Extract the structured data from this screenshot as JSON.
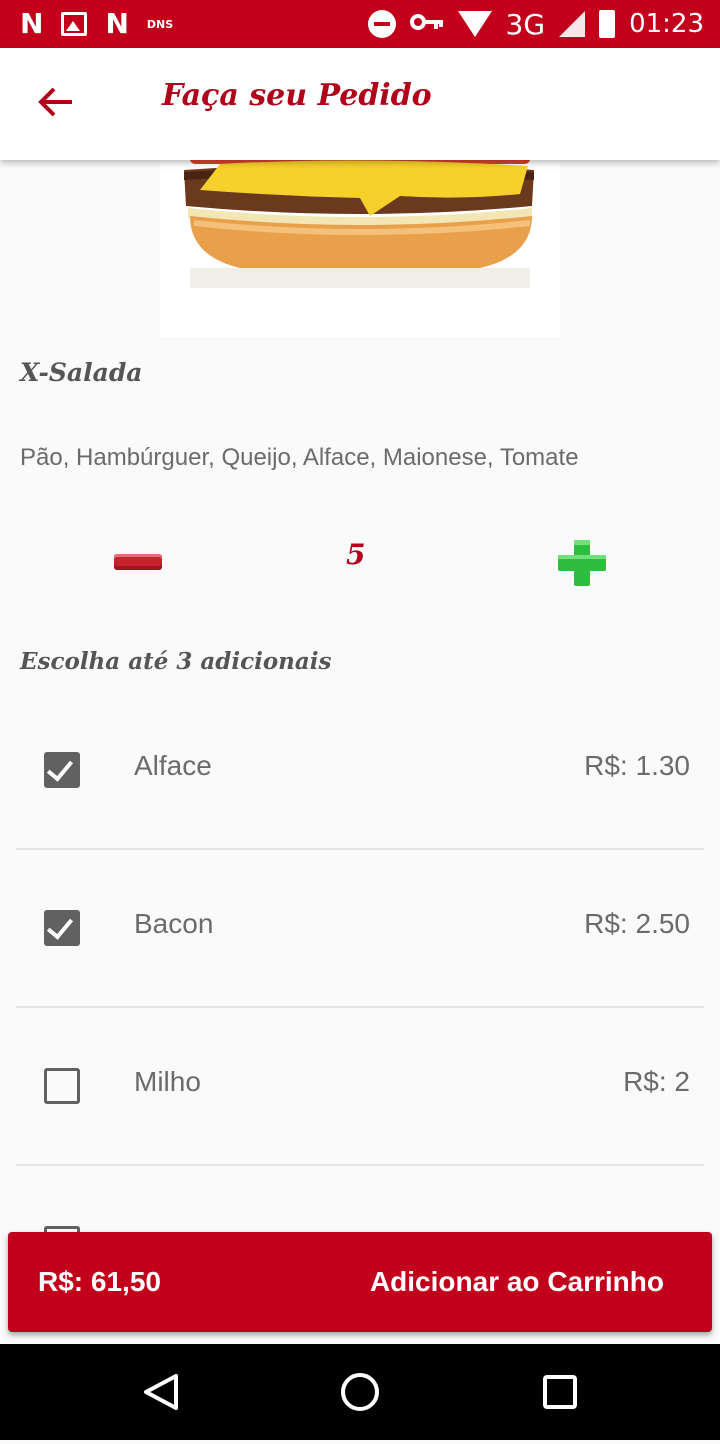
{
  "status_bar": {
    "left_icons": [
      "n-icon",
      "image-icon",
      "n-icon",
      "dns-icon"
    ],
    "dns_label": "DNS",
    "network_label": "3G",
    "time": "01:23"
  },
  "app_bar": {
    "title": "Faça seu Pedido",
    "back_icon": "arrow-left-icon"
  },
  "product": {
    "name": "X-Salada",
    "description": "Pão, Hambúrguer, Queijo, Alface, Maionese, Tomate",
    "quantity": "5"
  },
  "addons": {
    "title": "Escolha até 3 adicionais",
    "items": [
      {
        "label": "Alface",
        "price": "R$: 1.30",
        "checked": true
      },
      {
        "label": "Bacon",
        "price": "R$: 2.50",
        "checked": true
      },
      {
        "label": "Milho",
        "price": "R$: 2",
        "checked": false
      }
    ]
  },
  "footer": {
    "total": "R$: 61,50",
    "add_to_cart": "Adicionar ao Carrinho"
  },
  "colors": {
    "brand": "#c2001b",
    "plus_green": "#2ebd3e",
    "minus_red": "#c8212f"
  }
}
